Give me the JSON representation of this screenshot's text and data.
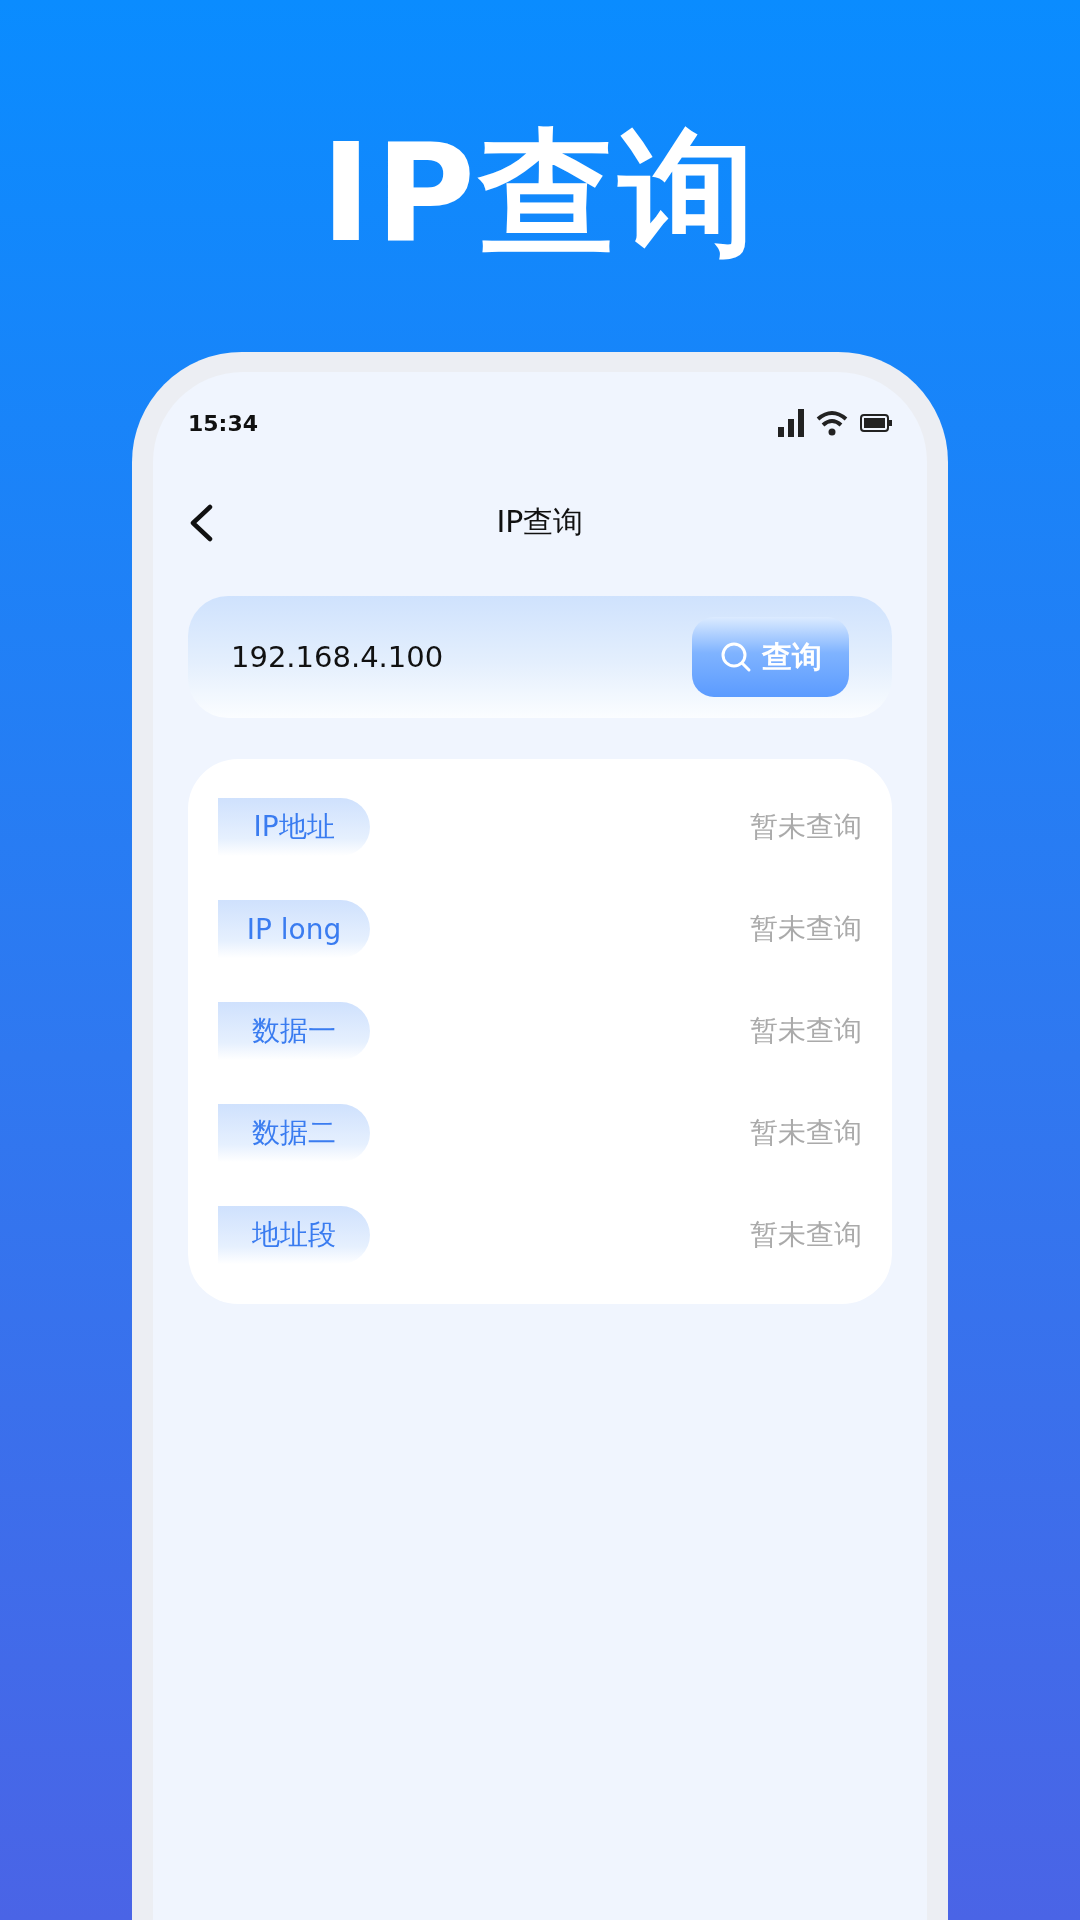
{
  "headline": "IP查询",
  "status_bar": {
    "time": "15:34"
  },
  "nav": {
    "title": "IP查询"
  },
  "search": {
    "value": "192.168.4.100",
    "button": "查询"
  },
  "results": [
    {
      "label": "IP地址",
      "value": "暂未查询"
    },
    {
      "label": "IP long",
      "value": "暂未查询"
    },
    {
      "label": "数据一",
      "value": "暂未查询"
    },
    {
      "label": "数据二",
      "value": "暂未查询"
    },
    {
      "label": "地址段",
      "value": "暂未查询"
    }
  ]
}
